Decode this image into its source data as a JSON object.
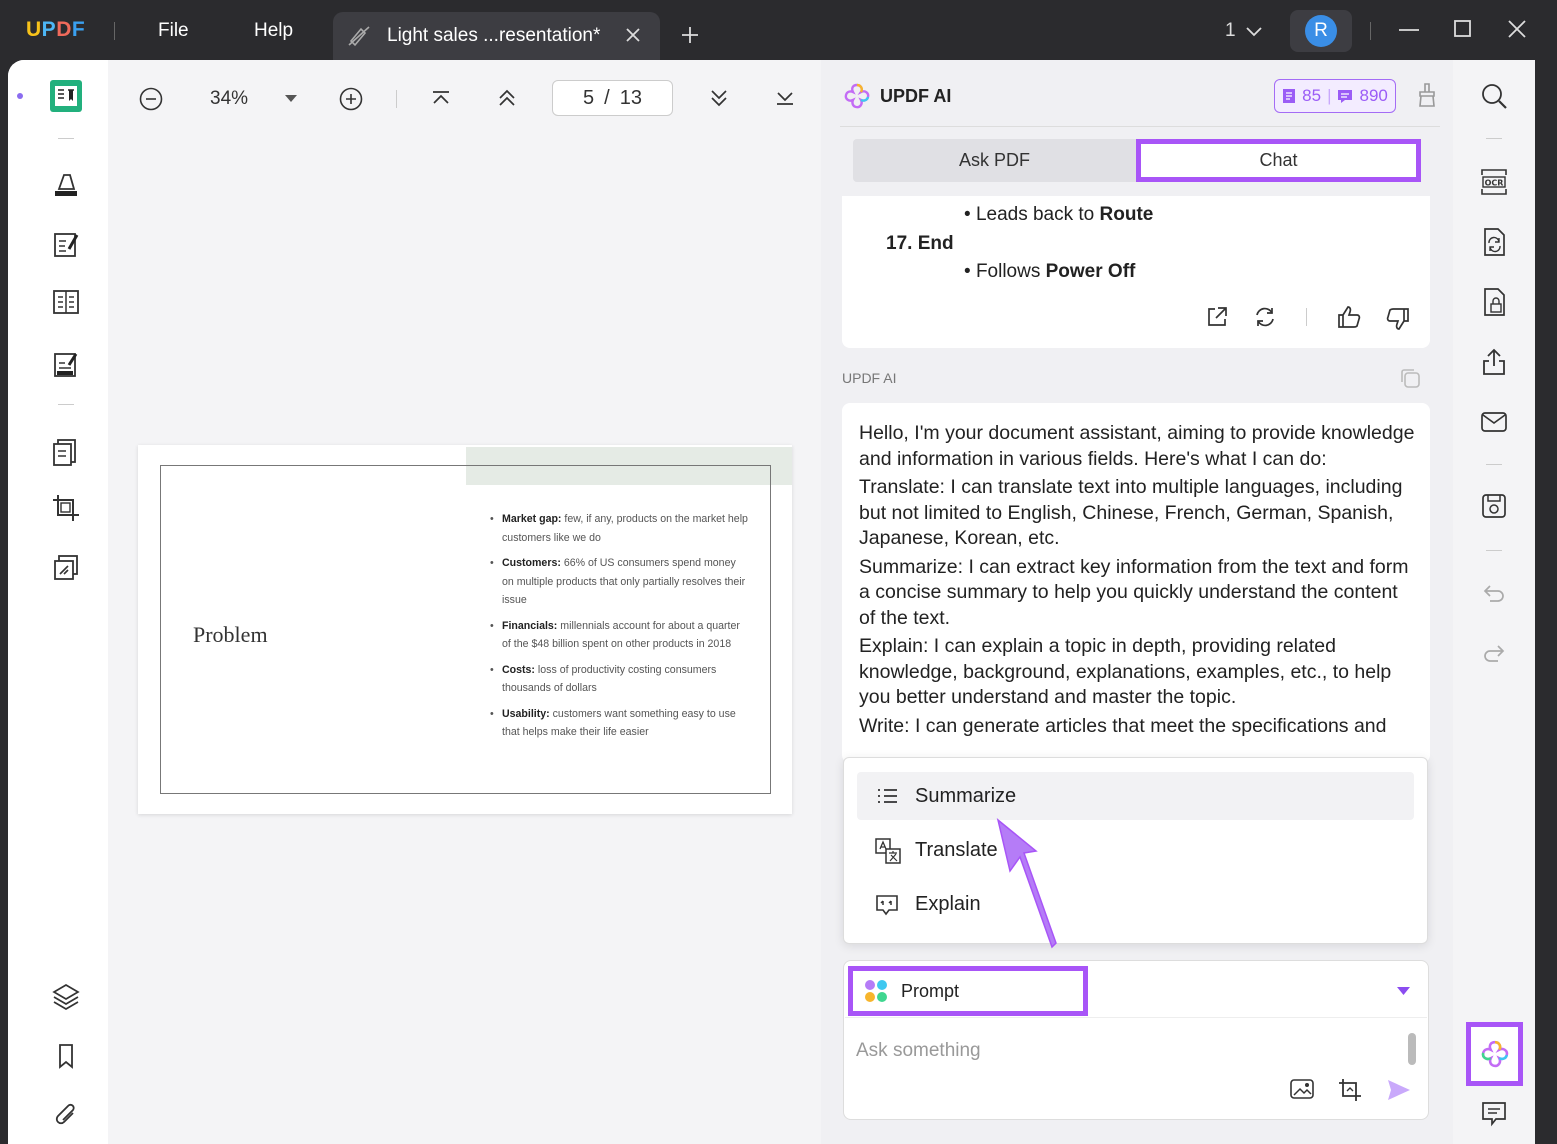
{
  "app": {
    "logo": "UPDF",
    "menu": [
      "File",
      "Help"
    ],
    "tab_title": "Light sales ...resentation*",
    "window_count": "1",
    "user_initial": "R"
  },
  "toolbar": {
    "zoom": "34%",
    "page_current": "5",
    "page_sep": "/",
    "page_total": "13"
  },
  "slide": {
    "title": "Problem",
    "bullets": [
      {
        "label": "Market gap:",
        "text": " few, if any, products on the market help customers like we do"
      },
      {
        "label": "Customers:",
        "text": " 66% of US consumers spend money on multiple products that only partially resolves their issue"
      },
      {
        "label": "Financials:",
        "text": " millennials account for about a quarter of the $48 billion spent on other products in 2018"
      },
      {
        "label": "Costs:",
        "text": " loss of productivity costing consumers thousands of dollars"
      },
      {
        "label": "Usability:",
        "text": " customers want something easy to use that helps make their life easier"
      }
    ]
  },
  "ai": {
    "title": "UPDF AI",
    "credits_a": "85",
    "credits_b": "890",
    "tabs": [
      "Ask PDF",
      "Chat"
    ],
    "prev": {
      "line1_pre": "Leads back to ",
      "line1_bold": "Route",
      "step": "17. End",
      "line2_pre": "Follows ",
      "line2_bold": "Power Off"
    },
    "sender": "UPDF AI",
    "response": [
      "Hello, I'm your document assistant, aiming to provide knowledge and information in various fields. Here's what I can do:",
      "Translate: I can translate text into multiple languages, including but not limited to English, Chinese, French, German, Spanish, Japanese, Korean, etc.",
      "Summarize: I can extract key information from the text and form a concise summary to help you quickly understand the content of the text.",
      "Explain: I can explain a topic in depth, providing related knowledge, background, explanations, examples, etc., to help you better understand and master the topic.",
      "Write: I can generate articles that meet the specifications and"
    ],
    "menu": [
      "Summarize",
      "Translate",
      "Explain"
    ],
    "prompt_label": "Prompt",
    "input_placeholder": "Ask something"
  },
  "colors": {
    "accent": "#a855f7",
    "logo_u": "#f7c21a",
    "logo_pdf": "#3aa0f0"
  }
}
